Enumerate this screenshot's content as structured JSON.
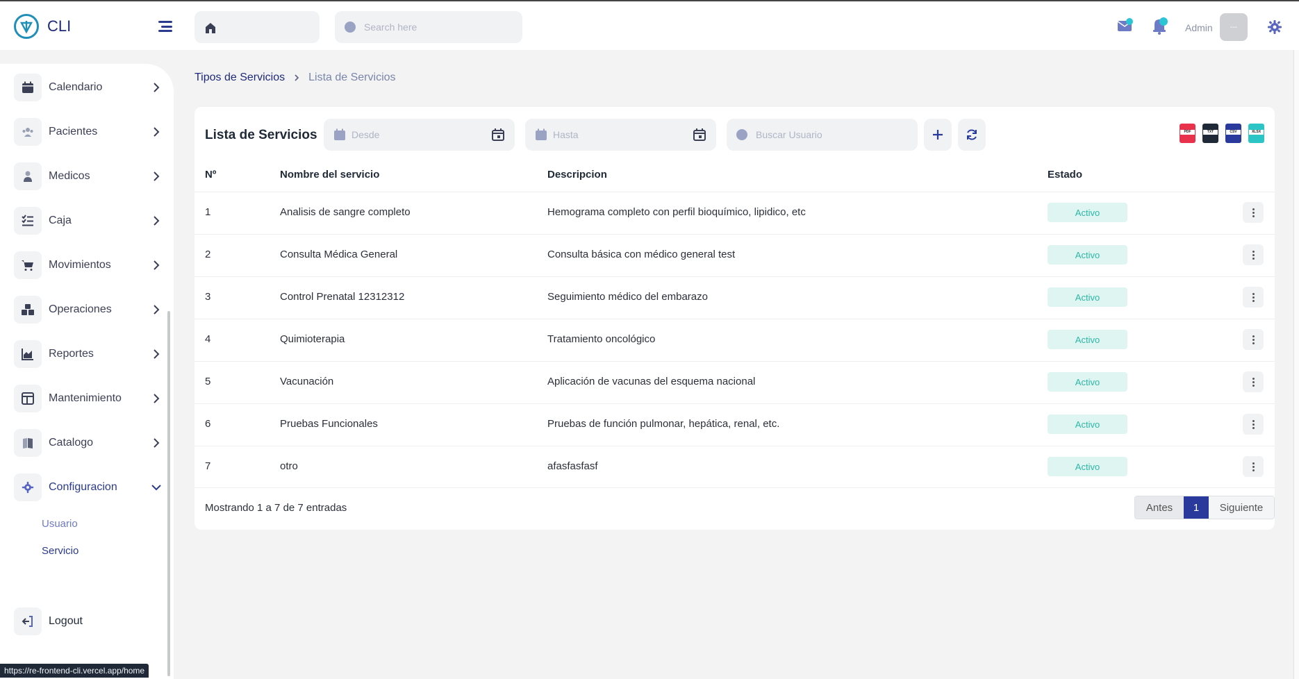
{
  "app": {
    "name": "CLI"
  },
  "header": {
    "search_placeholder": "Search here",
    "user_label": "Admin",
    "avatar_text": "---"
  },
  "sidebar": {
    "items": [
      {
        "label": "Calendario",
        "icon": "calendar-icon"
      },
      {
        "label": "Pacientes",
        "icon": "patients-icon"
      },
      {
        "label": "Medicos",
        "icon": "doctor-icon"
      },
      {
        "label": "Caja",
        "icon": "checklist-icon"
      },
      {
        "label": "Movimientos",
        "icon": "cart-icon"
      },
      {
        "label": "Operaciones",
        "icon": "boxes-icon"
      },
      {
        "label": "Reportes",
        "icon": "chart-icon"
      },
      {
        "label": "Mantenimiento",
        "icon": "layout-icon"
      },
      {
        "label": "Catalogo",
        "icon": "book-icon"
      },
      {
        "label": "Configuracion",
        "icon": "gear-icon"
      }
    ],
    "sub_items": [
      {
        "label": "Usuario"
      },
      {
        "label": "Servicio"
      }
    ],
    "logout_label": "Logout",
    "status_url": "https://re-frontend-cli.vercel.app/home"
  },
  "breadcrumb": {
    "parent": "Tipos de Servicios",
    "current": "Lista de Servicios"
  },
  "card": {
    "title": "Lista de Servicios",
    "from_placeholder": "Desde",
    "to_placeholder": "Hasta",
    "user_search_placeholder": "Buscar Usuario",
    "export_labels": [
      "PDF",
      "TXT",
      "CSV",
      "XLSX"
    ]
  },
  "table": {
    "headers": [
      "Nº",
      "Nombre del servicio",
      "Descripcion",
      "Estado"
    ],
    "rows": [
      {
        "n": "1",
        "name": "Analisis de sangre completo",
        "description": "Hemograma completo con perfil bioquímico, lipidico, etc",
        "status": "Activo"
      },
      {
        "n": "2",
        "name": "Consulta Médica General",
        "description": "Consulta básica con médico general test",
        "status": "Activo"
      },
      {
        "n": "3",
        "name": "Control Prenatal 12312312",
        "description": "Seguimiento médico del embarazo",
        "status": "Activo"
      },
      {
        "n": "4",
        "name": "Quimioterapia",
        "description": "Tratamiento oncológico",
        "status": "Activo"
      },
      {
        "n": "5",
        "name": "Vacunación",
        "description": "Aplicación de vacunas del esquema nacional",
        "status": "Activo"
      },
      {
        "n": "6",
        "name": "Pruebas Funcionales",
        "description": "Pruebas de función pulmonar, hepática, renal, etc.",
        "status": "Activo"
      },
      {
        "n": "7",
        "name": "otro",
        "description": "afasfasfasf",
        "status": "Activo"
      }
    ]
  },
  "pagination": {
    "summary": "Mostrando 1 a 7 de 7 entradas",
    "prev_label": "Antes",
    "current_page": "1",
    "next_label": "Siguiente"
  },
  "colors": {
    "brand": "#1e2a78",
    "accent": "#2a3a9c",
    "status_bg": "#dff5f2",
    "status_text": "#2cb7a5"
  }
}
